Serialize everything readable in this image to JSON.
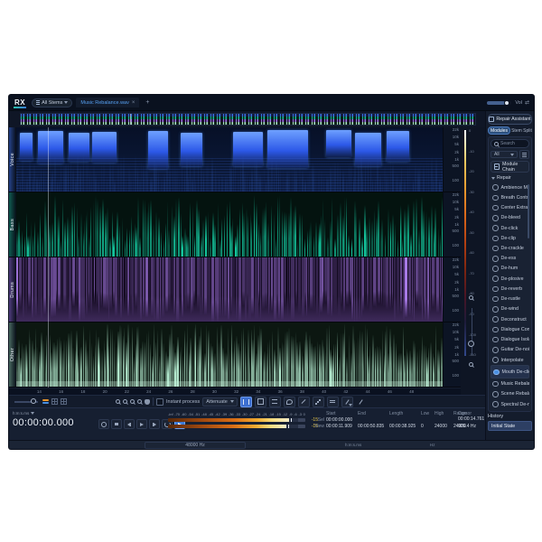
{
  "app": {
    "logo": "RX"
  },
  "topbar": {
    "stems_selector_label": "All Stems",
    "tab_label": "Music Rebalance.wav",
    "tab_close_glyph": "×",
    "new_tab_glyph": "+",
    "volume_label": "Vol"
  },
  "sidebar": {
    "repair_assistant_label": "Repair Assistant",
    "panel_tabs": [
      {
        "label": "Modules",
        "active": true
      },
      {
        "label": "Stem Split",
        "active": false
      }
    ],
    "search_placeholder": "Search",
    "category_filter_value": "All",
    "module_chain_label": "Module Chain",
    "section_label": "Repair",
    "modules": [
      "Ambience Match",
      "Breath Control",
      "Center Extract",
      "De-bleed",
      "De-click",
      "De-clip",
      "De-crackle",
      "De-ess",
      "De-hum",
      "De-plosive",
      "De-reverb",
      "De-rustle",
      "De-wind",
      "Deconstruct",
      "Dialogue Contour",
      "Dialogue Isolate",
      "Guitar De-noise",
      "Interpolate",
      "Mouth De-click",
      "Music Rebalance",
      "Scene Rebalance",
      "Spectral De-noise"
    ],
    "selected_module": "Mouth De-click"
  },
  "spectrogram": {
    "stems": [
      {
        "name": "Voice",
        "color": "#4a7df0"
      },
      {
        "name": "Bass",
        "color": "#19c3a0"
      },
      {
        "name": "Drums",
        "color": "#a579ea"
      },
      {
        "name": "Other",
        "color": "#ace6c9"
      }
    ],
    "freq_axis_labels": [
      "22k",
      "10k",
      "5k",
      "2k",
      "1k",
      "500",
      "100"
    ],
    "legend_db_labels": [
      "0",
      "-10",
      "-20",
      "-30",
      "-40",
      "-50",
      "-60",
      "-70",
      "-80",
      "-90",
      "-100",
      "-110"
    ],
    "time_ruler_ticks": [
      "14",
      "16",
      "18",
      "20",
      "22",
      "24",
      "26",
      "28",
      "30",
      "32",
      "34",
      "36",
      "38",
      "40",
      "42",
      "44",
      "46",
      "48"
    ]
  },
  "toolbar": {
    "instant_process_label": "Instant process",
    "selection_mode_value": "Attenuate"
  },
  "transport": {
    "time_format_label": "h:m:s.ms",
    "time_display": "00:00:00.000",
    "sample_rate": "48000 Hz",
    "meter_tick_labels": [
      "-inf",
      "-70",
      "-60",
      "-54",
      "-51",
      "-48",
      "-45",
      "-42",
      "-39",
      "-36",
      "-33",
      "-30",
      "-27",
      "-24",
      "-21",
      "-18",
      "-15",
      "-12",
      "-9",
      "-6",
      "-3",
      "0"
    ],
    "meter_peak_left": "-15",
    "meter_peak_right": "-15"
  },
  "selection_info": {
    "column_headers": [
      "Start",
      "End",
      "Length",
      "Low",
      "High",
      "Range"
    ],
    "row_labels": [
      "Sel",
      "View"
    ],
    "sel_row": [
      "00:00:00.000",
      "",
      "",
      "",
      "",
      ""
    ],
    "view_row": [
      "00:00:11.909",
      "00:00:50.835",
      "00:00:38.925",
      "0",
      "24000",
      "24000"
    ],
    "cursor_header": "Cursor",
    "cursor_time": "00:00:14.761",
    "cursor_freq": "926.4 Hz",
    "time_unit_label": "h:m:s.ms",
    "freq_unit_label": "Hz"
  },
  "history": {
    "title": "History",
    "items": [
      "Initial State"
    ]
  }
}
